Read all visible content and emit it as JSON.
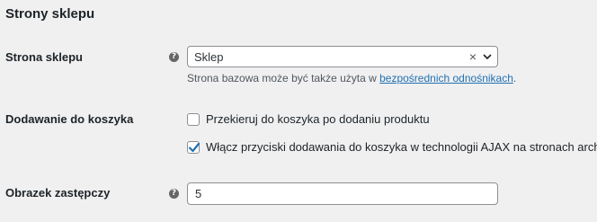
{
  "section": {
    "title": "Strony sklepu"
  },
  "shop_page": {
    "label": "Strona sklepu",
    "help_icon": "question-circle-icon",
    "selected_value": "Sklep",
    "clear_icon": "×",
    "description_prefix": "Strona bazowa może być także użyta w ",
    "description_link": "bezpośrednich odnośnikach",
    "description_suffix": "."
  },
  "add_to_cart": {
    "label": "Dodawanie do koszyka",
    "options": [
      {
        "label": "Przekieruj do koszyka po dodaniu produktu",
        "checked": false
      },
      {
        "label": "Włącz przyciski dodawania do koszyka w technologii AJAX na stronach archiwów",
        "checked": true
      }
    ]
  },
  "placeholder_image": {
    "label": "Obrazek zastępczy",
    "help_icon": "question-circle-icon",
    "value": "5"
  },
  "colors": {
    "background": "#f0f0f1",
    "link": "#2271b1",
    "border": "#8c8f94"
  }
}
